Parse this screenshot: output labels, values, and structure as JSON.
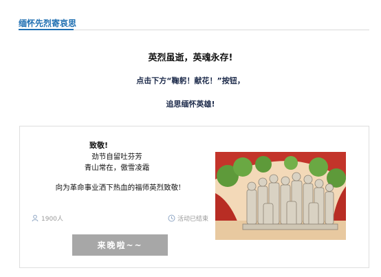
{
  "tab": {
    "title": "缅怀先烈寄哀思"
  },
  "intro": {
    "line1": "英烈虽逝，英魂永存!",
    "line2": "点击下方“鞠躬！献花！”按钮，",
    "line3": "追思缅怀英雄!"
  },
  "card": {
    "heading": "致敬!",
    "poem_line1": "劲节自留吐芬芳",
    "poem_line2": "青山常在，傲雪凌霜",
    "tribute": "向为革命事业洒下热血的福师英烈致敬!",
    "participants": "1900人",
    "participants_icon": "person-icon",
    "status": "活动已结束",
    "status_icon": "clock-icon",
    "button_label": "来晚啦~~",
    "button_color": "#a7a7a7"
  },
  "colors": {
    "accent": "#1f6fb2",
    "text_dark": "#1c2a4a",
    "muted": "#999999"
  }
}
